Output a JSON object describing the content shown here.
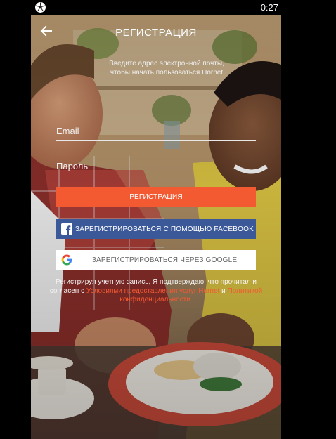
{
  "status_bar": {
    "time": "0:27",
    "app_icon": "soccer-ball-icon"
  },
  "header": {
    "back_icon": "arrow-left-icon",
    "title": "РЕГИСТРАЦИЯ"
  },
  "intro": {
    "line1": "Введите адрес электронной почты,",
    "line2": "чтобы начать пользоваться Hornet"
  },
  "form": {
    "email_placeholder": "Email",
    "password_placeholder": "Пароль",
    "register_label": "РЕГИСТРАЦИЯ",
    "facebook_label": "ЗАРЕГИСТРИРОВАТЬСЯ С ПОМОЩЬЮ FACEBOOK",
    "google_label": "ЗАРЕГИСТРИРОВАТЬСЯ ЧЕРЕЗ GOOGLE"
  },
  "legal": {
    "prefix": "Регистрируя учетную запись, Я подтверждаю, что прочитал и согласен с",
    "terms_link": "Условиями предоставления услуг Hornet",
    "and": "и",
    "privacy_link": "Политикой конфиденциальности."
  },
  "colors": {
    "accent": "#f35a32",
    "facebook": "#3b5998",
    "background": "#000000"
  }
}
